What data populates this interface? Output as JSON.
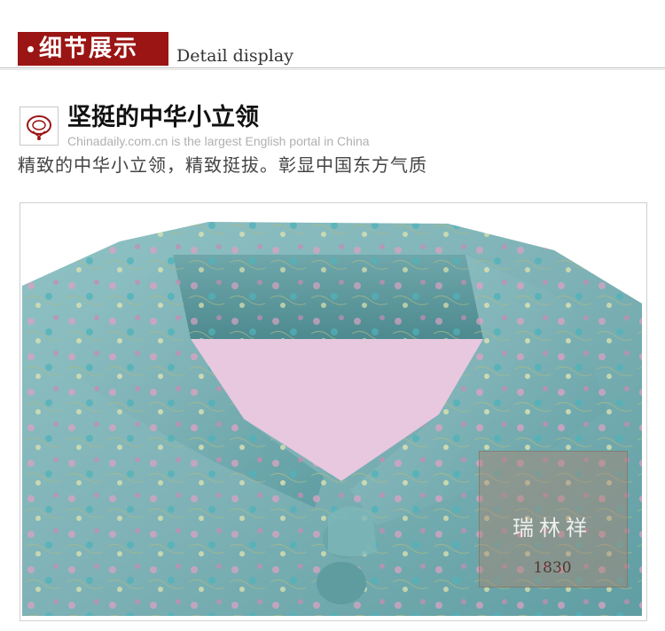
{
  "header": {
    "tag_label": "细节展示",
    "tag_subtitle": "Detail display",
    "accent_color": "#9a1514"
  },
  "section": {
    "icon": "collar-icon",
    "title": "坚挺的中华小立领",
    "caption": "Chinadaily.com.cn is the largest English portal in China",
    "description": "精致的中华小立领，精致挺拔。彰显中国东方气质"
  },
  "photo": {
    "subject": "collar-photo",
    "watermark_name": "瑞林祥",
    "watermark_year": "1830"
  }
}
